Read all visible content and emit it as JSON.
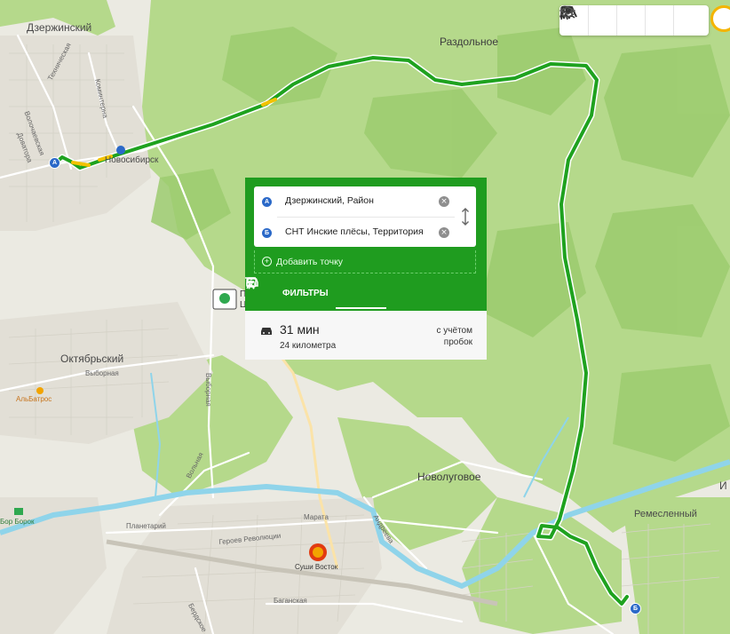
{
  "map": {
    "towns": {
      "dzerzhinsky": "Дзержинский",
      "razdolnoe": "Раздольное",
      "oktyabrsky": "Октябрьский",
      "novolugovoe": "Новолуговое",
      "remeslenny": "Ремесленный",
      "novosibirsk_fragment": "Новосибирск",
      "it_fragment": "И"
    },
    "streets": {
      "tekhnicheskaya": "Техническая",
      "volochaevskaya": "Волочаевская",
      "kommunalnaya": "Коминтерна",
      "dokatora": "Доватора",
      "vyborgnaya": "Выборная",
      "vyborgnaya2": "Выборная",
      "volnaya": "Вольная",
      "planetary": "Планетарий",
      "geroev": "Героев Революции",
      "marata": "Марата",
      "andreeva": "Андреева",
      "baganskaya": "Баганская",
      "berdskoe": "Бердское"
    },
    "pois": {
      "albatros": "АльБатрос",
      "sushi": "Суши Восток",
      "ber_borok": "Бор Борок",
      "p_fragment": "П",
      "c_fragment": "Ц"
    },
    "markers": {
      "start": "А",
      "end": "Б"
    }
  },
  "controls": {
    "layer_icons": [
      "route-person-icon",
      "people-icon",
      "metro-icon",
      "bus-icon",
      "layers-icon"
    ]
  },
  "route_panel": {
    "from": {
      "badge": "А",
      "value": "Дзержинский, Район"
    },
    "to": {
      "badge": "Б",
      "value": "СНТ Инские плёсы, Территория"
    },
    "add_point": "Добавить точку",
    "filters_label": "ФИЛЬТРЫ",
    "modes": [
      "car",
      "walk",
      "transit"
    ],
    "active_mode": "car",
    "result": {
      "duration": "31 мин",
      "distance": "24 километра",
      "traffic_line1": "с учётом",
      "traffic_line2": "пробок"
    }
  },
  "colors": {
    "route": "#1fa21f",
    "route_slow": "#f2c200",
    "panel": "#1f9c1f",
    "forest": "#a9d27a",
    "river": "#8fd4ea",
    "marker": "#2b69c8"
  }
}
